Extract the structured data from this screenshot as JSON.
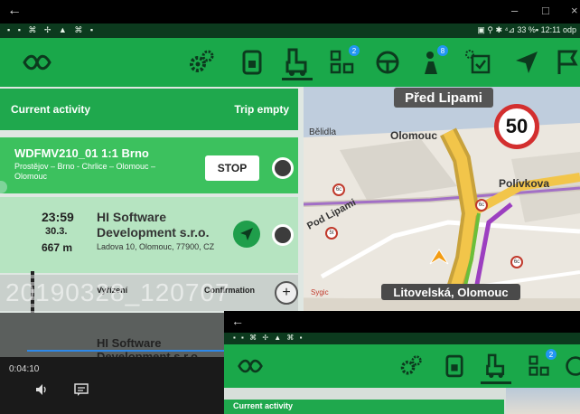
{
  "window": {
    "back": "←",
    "minimize": "–",
    "maximize": "□",
    "close": "×"
  },
  "statusbar": {
    "left_icons": "▪ ▪ ⌘ ✢ ▲ ⌘ ▪",
    "right": "▣ ⚲ ✱ ⁴⊿ 33 %▪ 12:11 odp"
  },
  "toolbar": {
    "icons": [
      "logo-icon",
      "settings-icon",
      "document-icon",
      "truck-icon",
      "pallets-icon",
      "steering-icon",
      "driver-icon",
      "calendar-check-icon",
      "navigate-icon",
      "flag-icon"
    ],
    "badges": {
      "pallets": "2",
      "driver": "8"
    }
  },
  "activity": {
    "title": "Current activity",
    "status": "Trip empty"
  },
  "trip": {
    "code": "WDFMV210_01 1:1 Brno",
    "route": "Prostějov – Brno - Chrlice – Olomouc – Olomouc",
    "stop_label": "STOP"
  },
  "stop": {
    "time": "23:59",
    "date": "30.3.",
    "distance": "667 m",
    "company": "HI Software Development s.r.o.",
    "address": "Ladova 10, Olomouc, 77900, CZ"
  },
  "confirm": {
    "left": "Vyřízení",
    "right": "Confirmation",
    "plus": "+"
  },
  "watermark": "20190328_120707",
  "lower": {
    "company": "HI Software Development s.r.o."
  },
  "player": {
    "timestamp": "0:04:10",
    "volume_icon": "volume-icon",
    "subtitles_icon": "subtitles-icon"
  },
  "map": {
    "street_top": "Před Lipami",
    "speed_limit": "50",
    "street_bottom": "Litovelská, Olomouc",
    "labels": {
      "belidla": "Bělidla",
      "olomouc": "Olomouc",
      "polivkova": "Polívkova",
      "pod_lipami": "Pod Lipami",
      "sygic": "Sygic"
    },
    "roads": {
      "r1": "6c",
      "r2": "6c",
      "r3": "5t",
      "r4": "6c"
    }
  },
  "overlay": {
    "back": "←",
    "status_icons": "▪ ▪ ⌘ ✢ ▲ ⌘ ▪",
    "activity_title": "Current activity",
    "badge": "2"
  }
}
